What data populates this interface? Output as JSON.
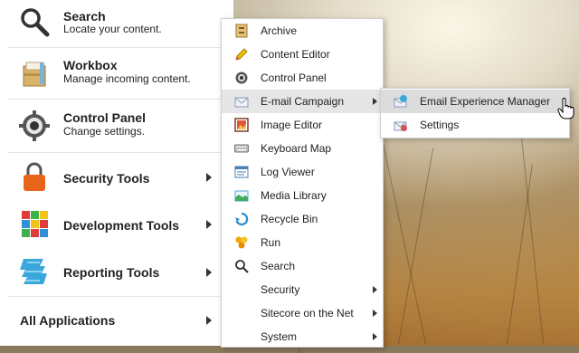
{
  "start_menu": {
    "items": [
      {
        "title": "Search",
        "subtitle": "Locate your content."
      },
      {
        "title": "Workbox",
        "subtitle": "Manage incoming content."
      },
      {
        "title": "Control Panel",
        "subtitle": "Change settings."
      },
      {
        "title": "Security Tools"
      },
      {
        "title": "Development Tools"
      },
      {
        "title": "Reporting Tools"
      }
    ],
    "all_applications": "All Applications"
  },
  "context_menu": {
    "items": [
      {
        "label": "Archive",
        "icon": "archive-icon"
      },
      {
        "label": "Content Editor",
        "icon": "pencil-icon"
      },
      {
        "label": "Control Panel",
        "icon": "gear-icon"
      },
      {
        "label": "E-mail Campaign",
        "icon": "envelope-icon",
        "submenu": true,
        "highlighted": true
      },
      {
        "label": "Image Editor",
        "icon": "picture-icon"
      },
      {
        "label": "Keyboard Map",
        "icon": "keyboard-icon"
      },
      {
        "label": "Log Viewer",
        "icon": "log-icon"
      },
      {
        "label": "Media Library",
        "icon": "media-icon"
      },
      {
        "label": "Recycle Bin",
        "icon": "recycle-icon"
      },
      {
        "label": "Run",
        "icon": "run-icon"
      },
      {
        "label": "Search",
        "icon": "search-icon"
      },
      {
        "label": "Security",
        "submenu": true
      },
      {
        "label": "Sitecore on the Net",
        "submenu": true
      },
      {
        "label": "System",
        "submenu": true
      }
    ]
  },
  "submenu": {
    "items": [
      {
        "label": "Email Experience Manager",
        "icon": "email-manager-icon",
        "highlighted": true
      },
      {
        "label": "Settings",
        "icon": "email-settings-icon"
      }
    ]
  },
  "colors": {
    "menu_background": "#ffffff",
    "highlight": "#e6e6e6",
    "lock_orange": "#e8641b",
    "reporting_blue": "#3aa7dc"
  }
}
